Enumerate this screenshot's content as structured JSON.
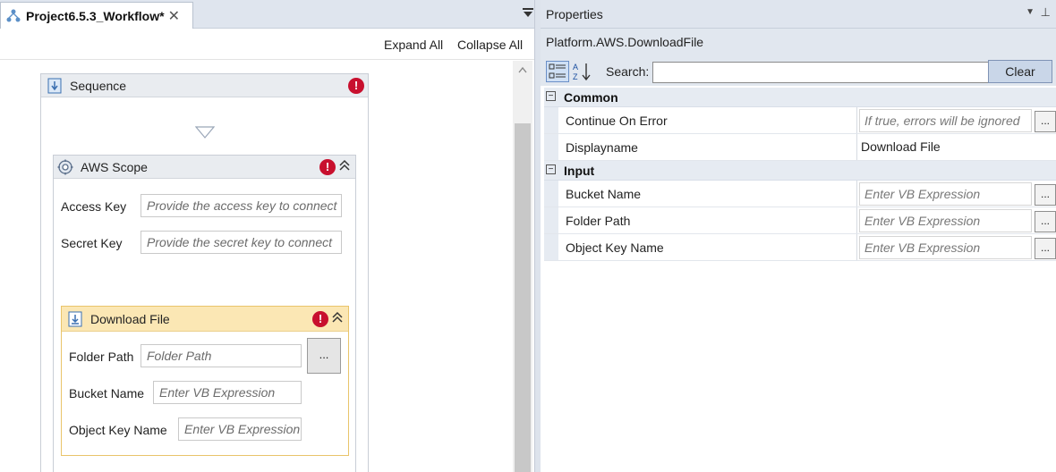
{
  "designer": {
    "tab_title": "Project6.5.3_Workflow*",
    "tab_close": "✕",
    "toolbar": {
      "expand_all": "Expand All",
      "collapse_all": "Collapse All"
    },
    "sequence": {
      "label": "Sequence",
      "error": "!"
    },
    "aws_scope": {
      "label": "AWS Scope",
      "error": "!",
      "collapse": "⌃⌃",
      "access_key_label": "Access Key",
      "access_key_placeholder": "Provide the access key to connect",
      "secret_key_label": "Secret Key",
      "secret_key_placeholder": "Provide the secret key to connect"
    },
    "download_file": {
      "label": "Download File",
      "error": "!",
      "collapse": "⌃⌃",
      "folder_path_label": "Folder Path",
      "folder_path_placeholder": "Folder Path",
      "browse_label": "...",
      "bucket_name_label": "Bucket Name",
      "bucket_name_placeholder": "Enter VB Expression",
      "object_key_label": "Object Key Name",
      "object_key_placeholder": "Enter VB Expression"
    }
  },
  "properties": {
    "title": "Properties",
    "dropdown": "▼",
    "pin": "⊥",
    "type_name": "Platform.AWS.DownloadFile",
    "search_label": "Search:",
    "search_value": "",
    "clear_label": "Clear",
    "categories": [
      {
        "name": "Common",
        "toggle": "−",
        "rows": [
          {
            "name": "Continue On Error",
            "placeholder": "If true, errors will be ignored",
            "ellipsis": "..."
          },
          {
            "name": "Displayname",
            "value": "Download File"
          }
        ]
      },
      {
        "name": "Input",
        "toggle": "−",
        "rows": [
          {
            "name": "Bucket Name",
            "placeholder": "Enter VB Expression",
            "ellipsis": "..."
          },
          {
            "name": "Folder Path",
            "placeholder": "Enter VB Expression",
            "ellipsis": "..."
          },
          {
            "name": "Object Key Name",
            "placeholder": "Enter VB Expression",
            "ellipsis": "..."
          }
        ]
      }
    ]
  },
  "colors": {
    "error": "#c8102e",
    "activity_highlight": "#fbe7b4",
    "pane_header": "#dfe5ee"
  }
}
